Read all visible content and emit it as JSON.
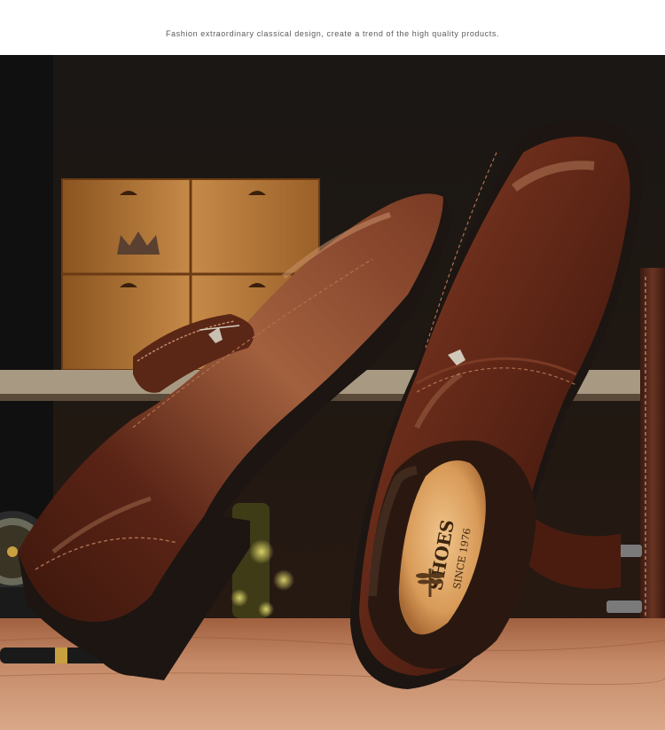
{
  "banner": {
    "tagline": "Fashion extraordinary classical design, create a trend of the high quality products."
  },
  "photo": {
    "subject": "brown leather slip-on shoes",
    "insole_brand": "SHOES",
    "insole_since": "SINCE 1976"
  },
  "colors": {
    "leather": "#5a2616",
    "leather_highlight": "#9a5a3e",
    "sole": "#1a1412",
    "table": "#b9785a",
    "background": "#1c130f",
    "crate": "#c07a3e"
  }
}
